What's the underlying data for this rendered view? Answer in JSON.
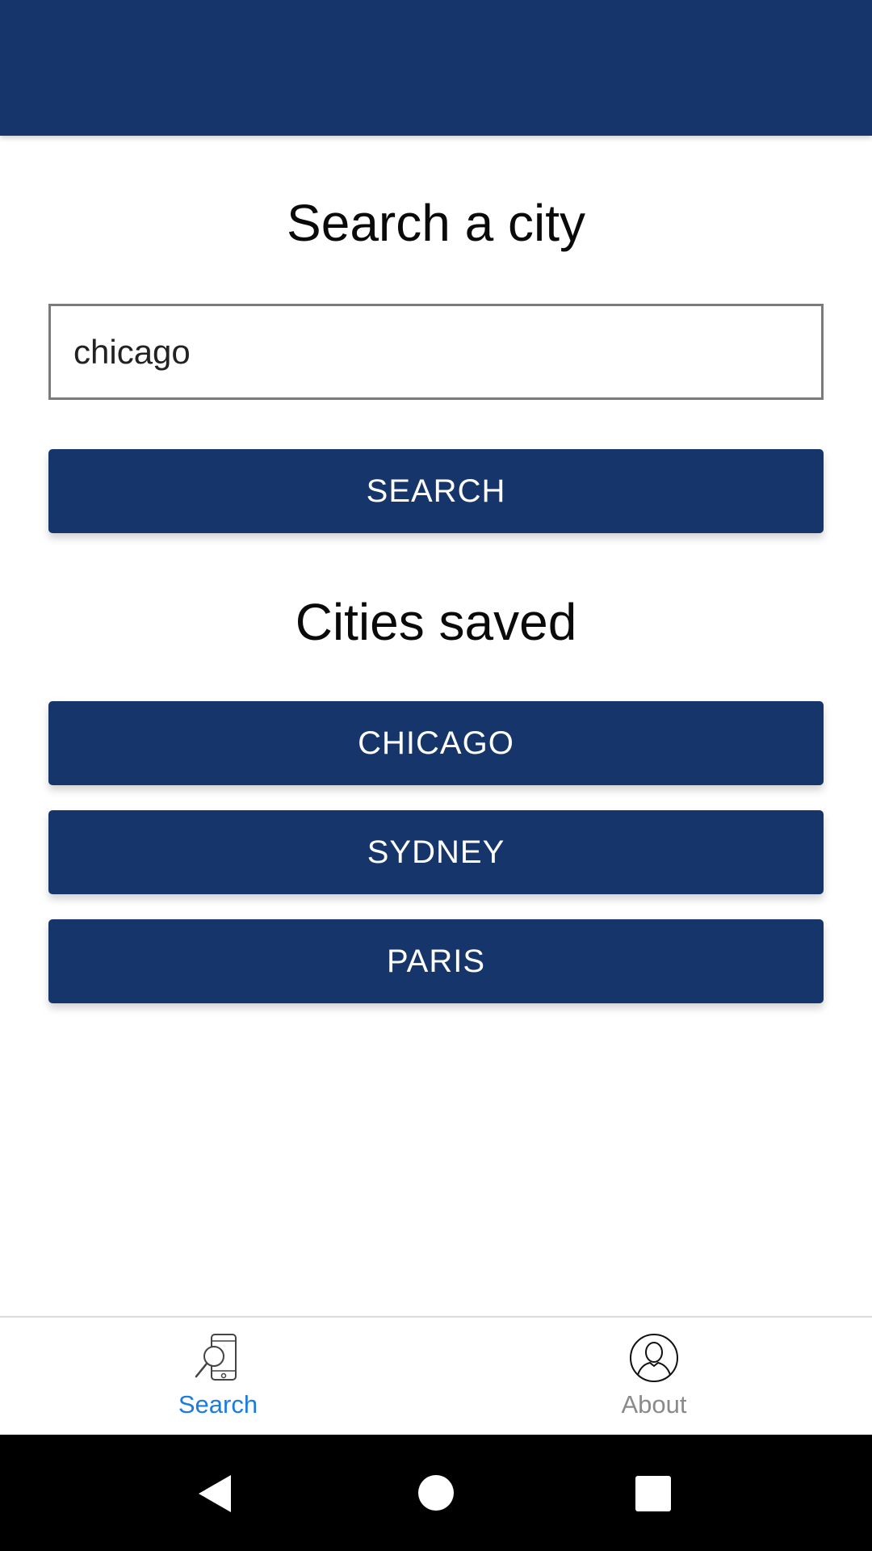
{
  "search_section": {
    "title": "Search a city",
    "input_value": "chicago",
    "button_label": "SEARCH"
  },
  "saved_section": {
    "title": "Cities saved",
    "cities": [
      "CHICAGO",
      "SYDNEY",
      "PARIS"
    ]
  },
  "bottom_nav": {
    "items": [
      {
        "label": "Search",
        "icon": "phone-search-icon",
        "active": true
      },
      {
        "label": "About",
        "icon": "user-circle-icon",
        "active": false
      }
    ]
  },
  "system_nav": {
    "items": [
      "back-icon",
      "home-icon",
      "recents-icon"
    ]
  },
  "colors": {
    "primary": "#16366b",
    "active_tab": "#1c7be0",
    "inactive_tab": "#8a8a8a"
  }
}
